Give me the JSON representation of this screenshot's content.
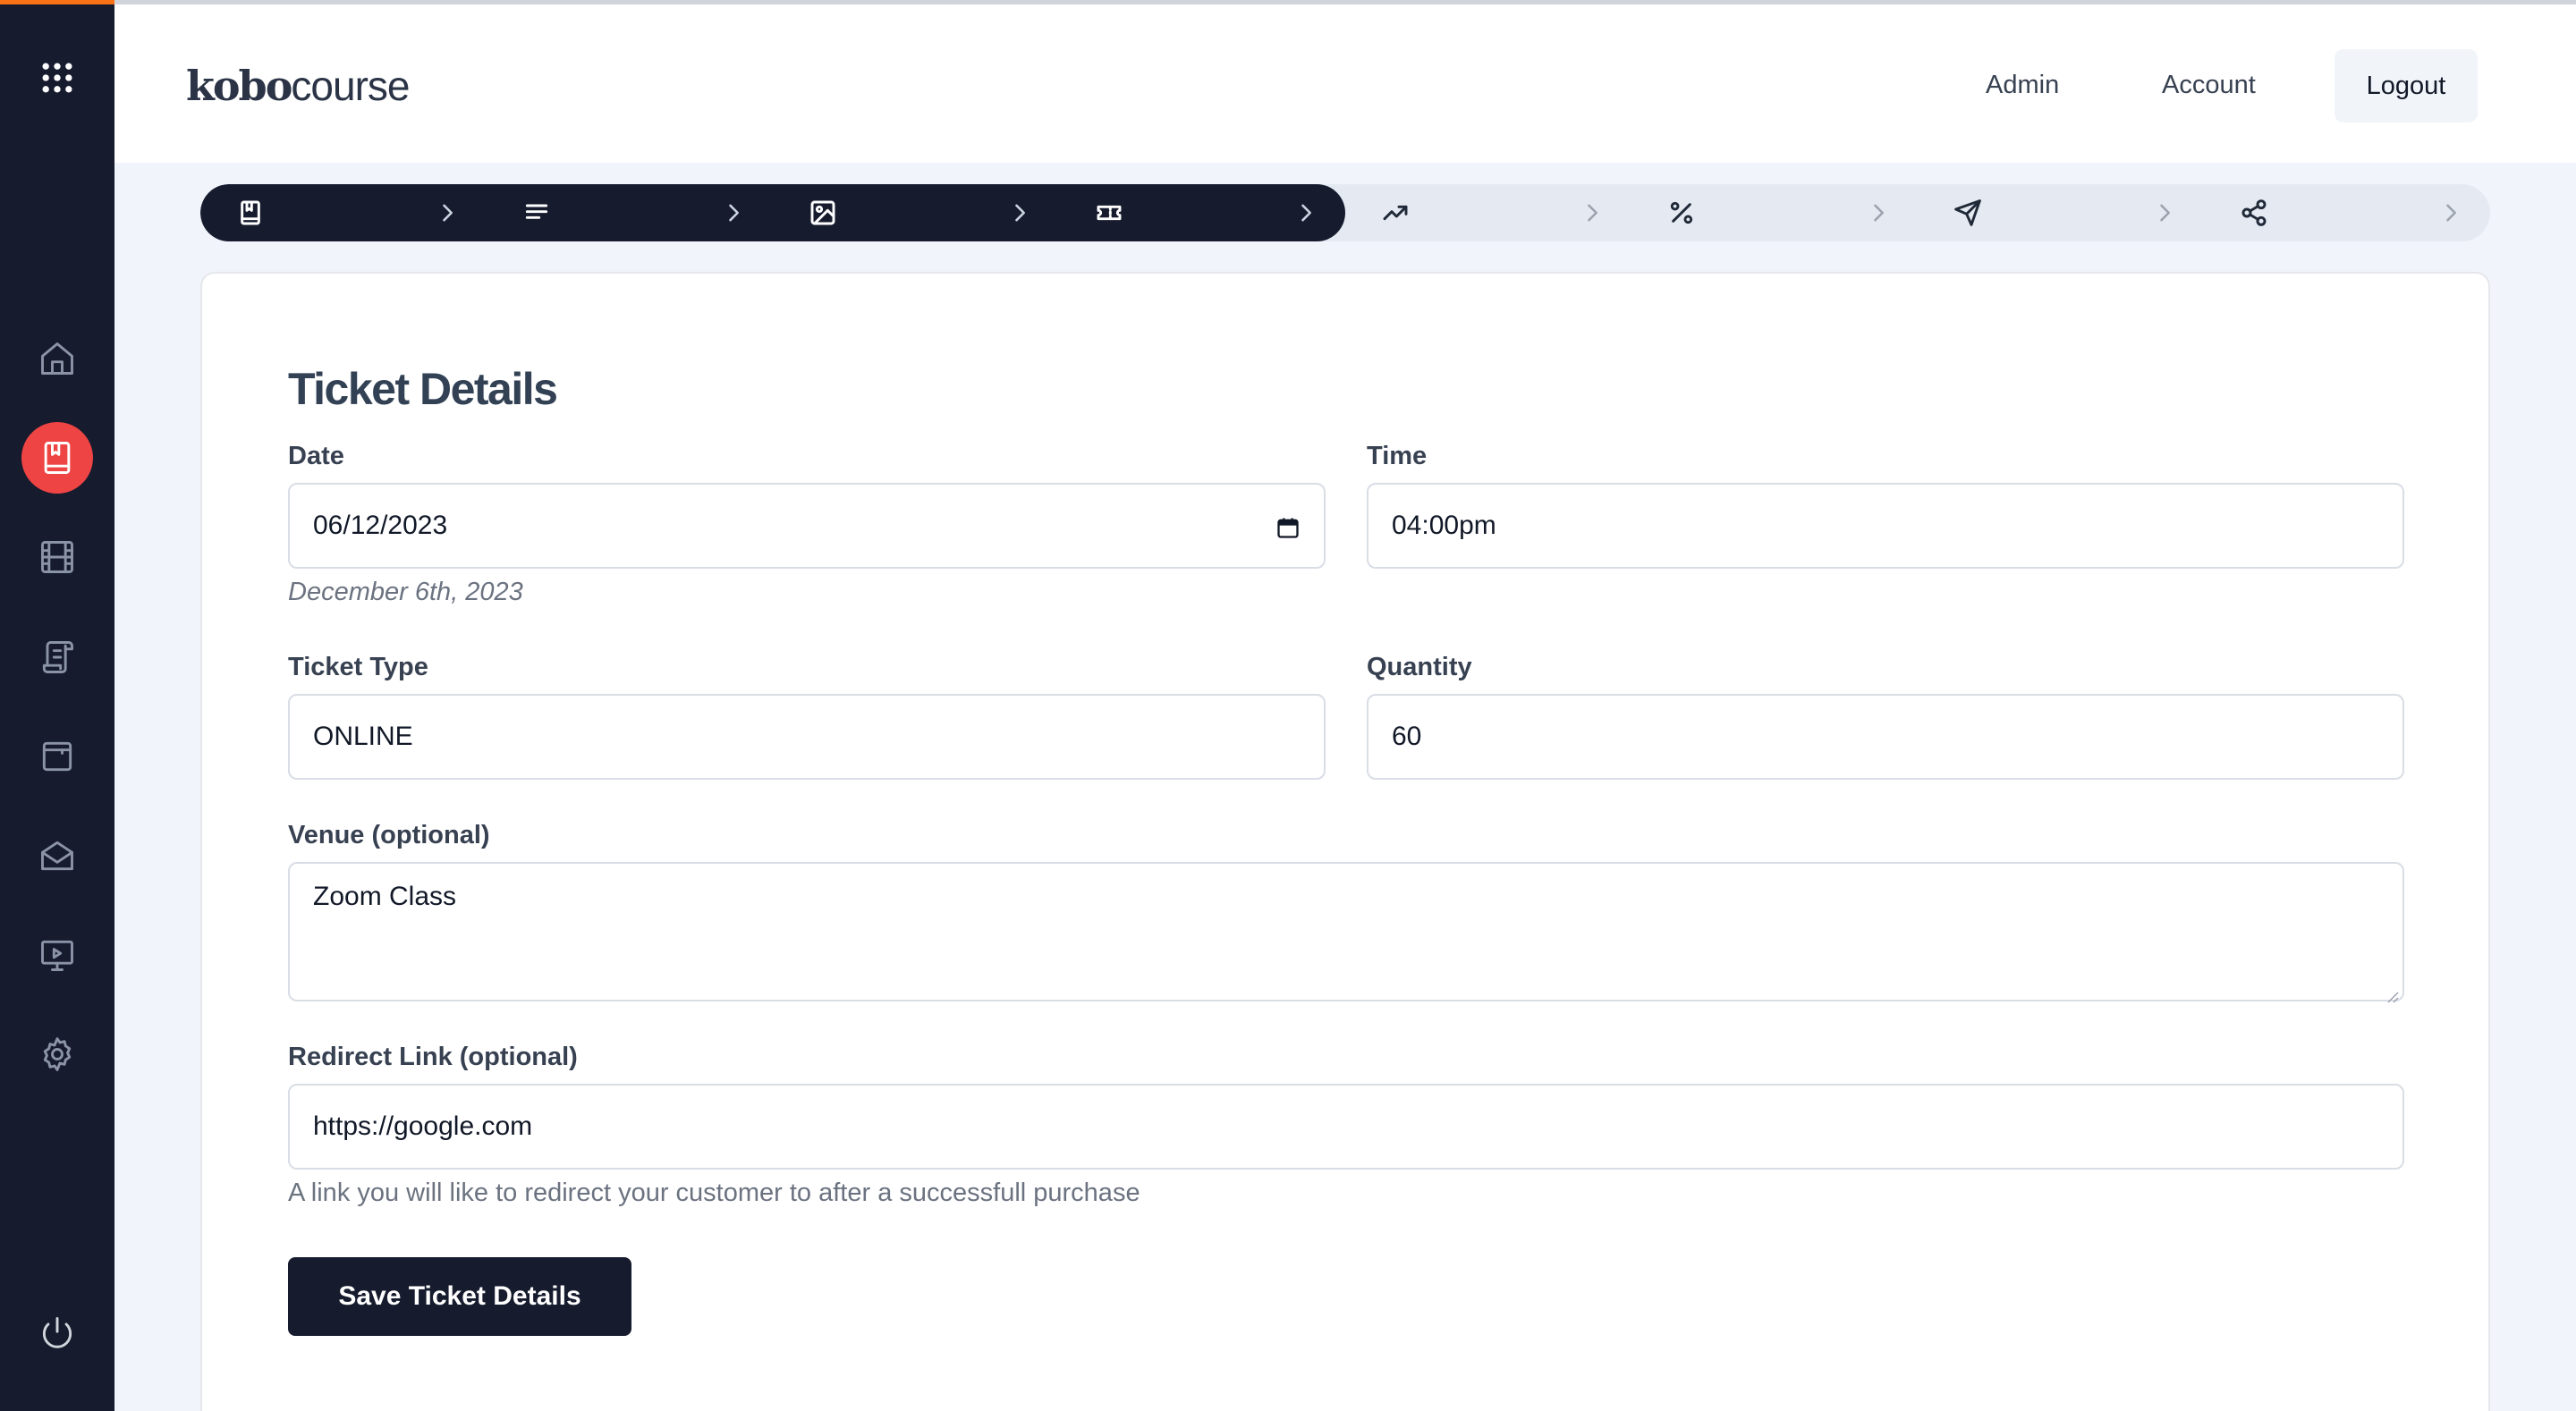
{
  "app": {
    "logo_bold": "kobo",
    "logo_light": "course"
  },
  "header": {
    "admin_label": "Admin",
    "account_label": "Account",
    "logout_label": "Logout"
  },
  "sidebar": {
    "items": [
      {
        "icon": "apps-grid-icon"
      },
      {
        "icon": "home-icon"
      },
      {
        "icon": "book-icon",
        "active": true
      },
      {
        "icon": "film-icon"
      },
      {
        "icon": "scroll-icon"
      },
      {
        "icon": "wallet-icon"
      },
      {
        "icon": "mail-icon"
      },
      {
        "icon": "presentation-icon"
      },
      {
        "icon": "settings-icon"
      },
      {
        "icon": "power-icon"
      }
    ]
  },
  "stepper": {
    "progress": 0.5,
    "steps": [
      {
        "icon": "book-icon",
        "done": true
      },
      {
        "icon": "align-left-icon",
        "done": true
      },
      {
        "icon": "image-icon",
        "done": true
      },
      {
        "icon": "ticket-icon",
        "done": true
      },
      {
        "icon": "trending-up-icon",
        "done": false
      },
      {
        "icon": "percent-icon",
        "done": false
      },
      {
        "icon": "send-icon",
        "done": false
      },
      {
        "icon": "share-icon",
        "done": false
      }
    ]
  },
  "form": {
    "title": "Ticket Details",
    "date": {
      "label": "Date",
      "value": "06/12/2023",
      "hint": "December 6th, 2023"
    },
    "time": {
      "label": "Time",
      "value": "04:00pm"
    },
    "ticket_type": {
      "label": "Ticket Type",
      "value": "ONLINE"
    },
    "quantity": {
      "label": "Quantity",
      "value": "60"
    },
    "venue": {
      "label": "Venue (optional)",
      "value": "Zoom Class"
    },
    "redirect": {
      "label": "Redirect Link (optional)",
      "value": "https://google.com",
      "hint": "A link you will like to redirect your customer to after a successfull purchase"
    },
    "save_label": "Save Ticket Details"
  },
  "colors": {
    "sidebar_bg": "#161b2e",
    "active_accent": "#ef4444",
    "stepper_done": "#161b2e",
    "stepper_todo": "#e5e9f2"
  }
}
